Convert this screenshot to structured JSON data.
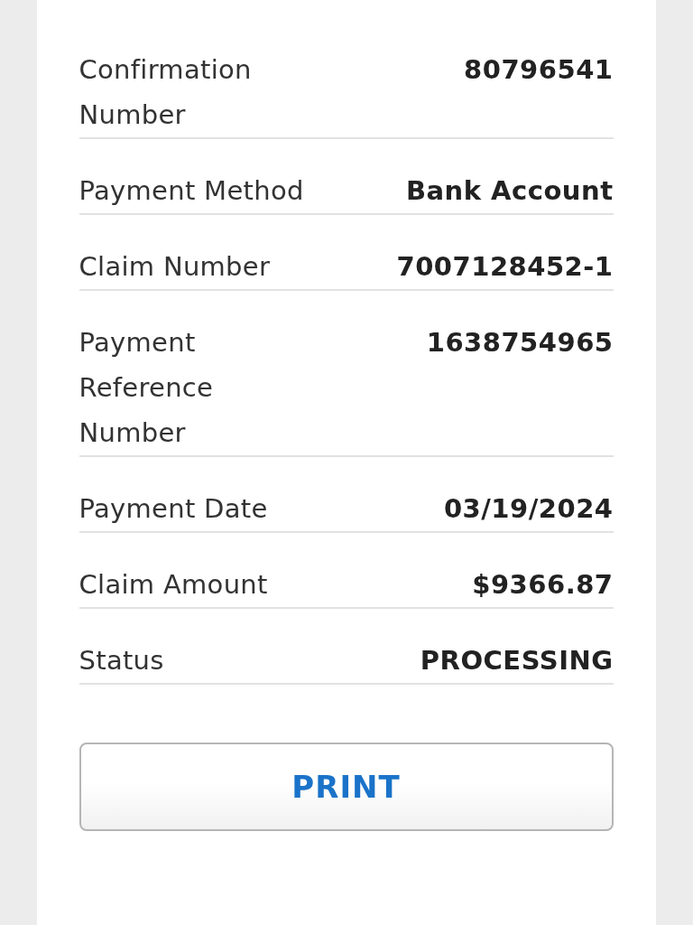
{
  "details": [
    {
      "label": "Confirmation Number",
      "value": "80796541"
    },
    {
      "label": "Payment Method",
      "value": "Bank Account"
    },
    {
      "label": "Claim Number",
      "value": "7007128452-1"
    },
    {
      "label": "Payment Reference Number",
      "value": "1638754965"
    },
    {
      "label": "Payment Date",
      "value": "03/19/2024"
    },
    {
      "label": "Claim Amount",
      "value": "$9366.87"
    },
    {
      "label": "Status",
      "value": "PROCESSING"
    }
  ],
  "print_button": "PRINT"
}
